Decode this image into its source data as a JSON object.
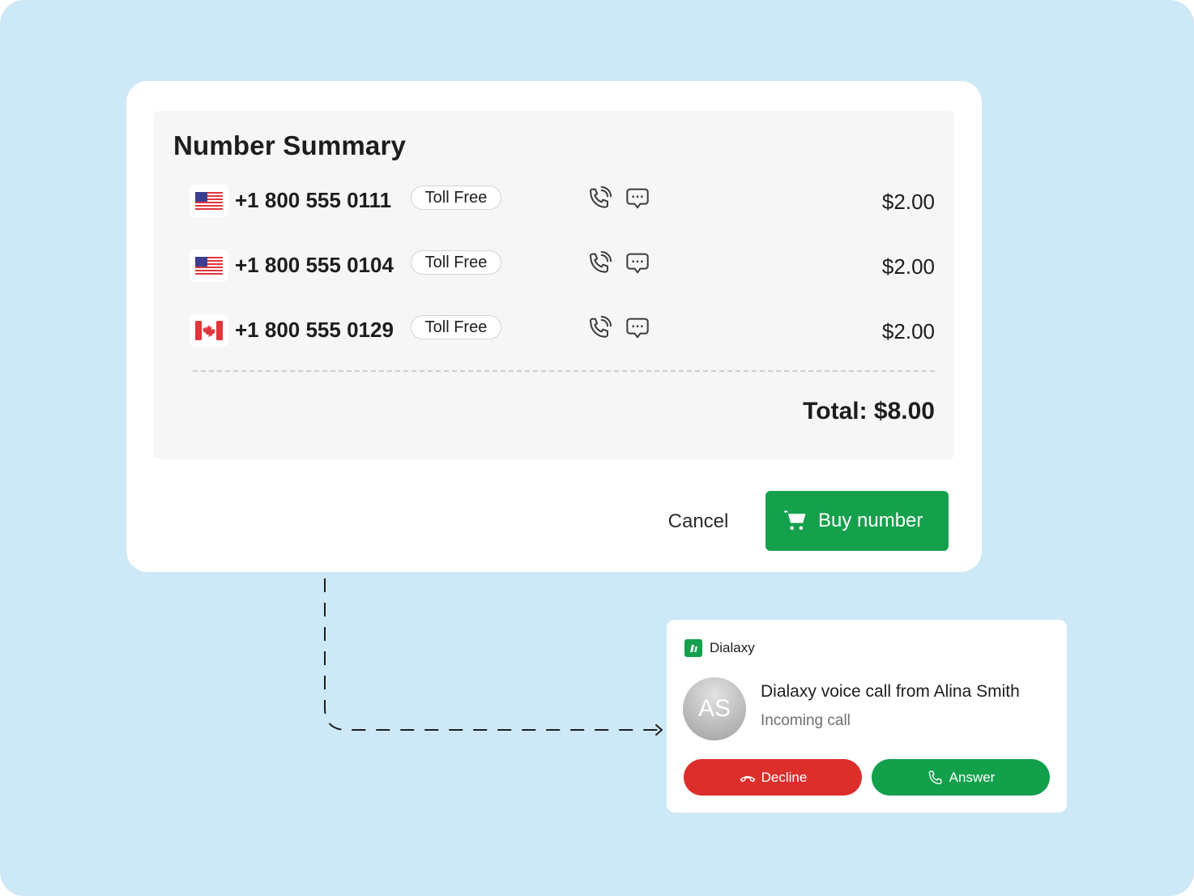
{
  "summary": {
    "title": "Number Summary",
    "rows": [
      {
        "flag": "us-flag-icon",
        "number": "+1 800 555 0111",
        "type": "Toll Free",
        "price": "$2.00"
      },
      {
        "flag": "us-flag-icon",
        "number": "+1 800 555 0104",
        "type": "Toll Free",
        "price": "$2.00"
      },
      {
        "flag": "canada-flag-icon",
        "number": "+1 800 555 0129",
        "type": "Toll Free",
        "price": "$2.00"
      }
    ],
    "total": "Total: $8.00",
    "cancel_label": "Cancel",
    "buy_label": "Buy number"
  },
  "notification": {
    "app_name": "Dialaxy",
    "avatar_initials": "AS",
    "title": "Dialaxy voice call from Alina Smith",
    "subtitle": "Incoming call",
    "decline_label": "Decline",
    "answer_label": "Answer"
  },
  "colors": {
    "background": "#cde8f6",
    "accent_green": "#15a04c",
    "decline_red": "#dc2e2b"
  }
}
